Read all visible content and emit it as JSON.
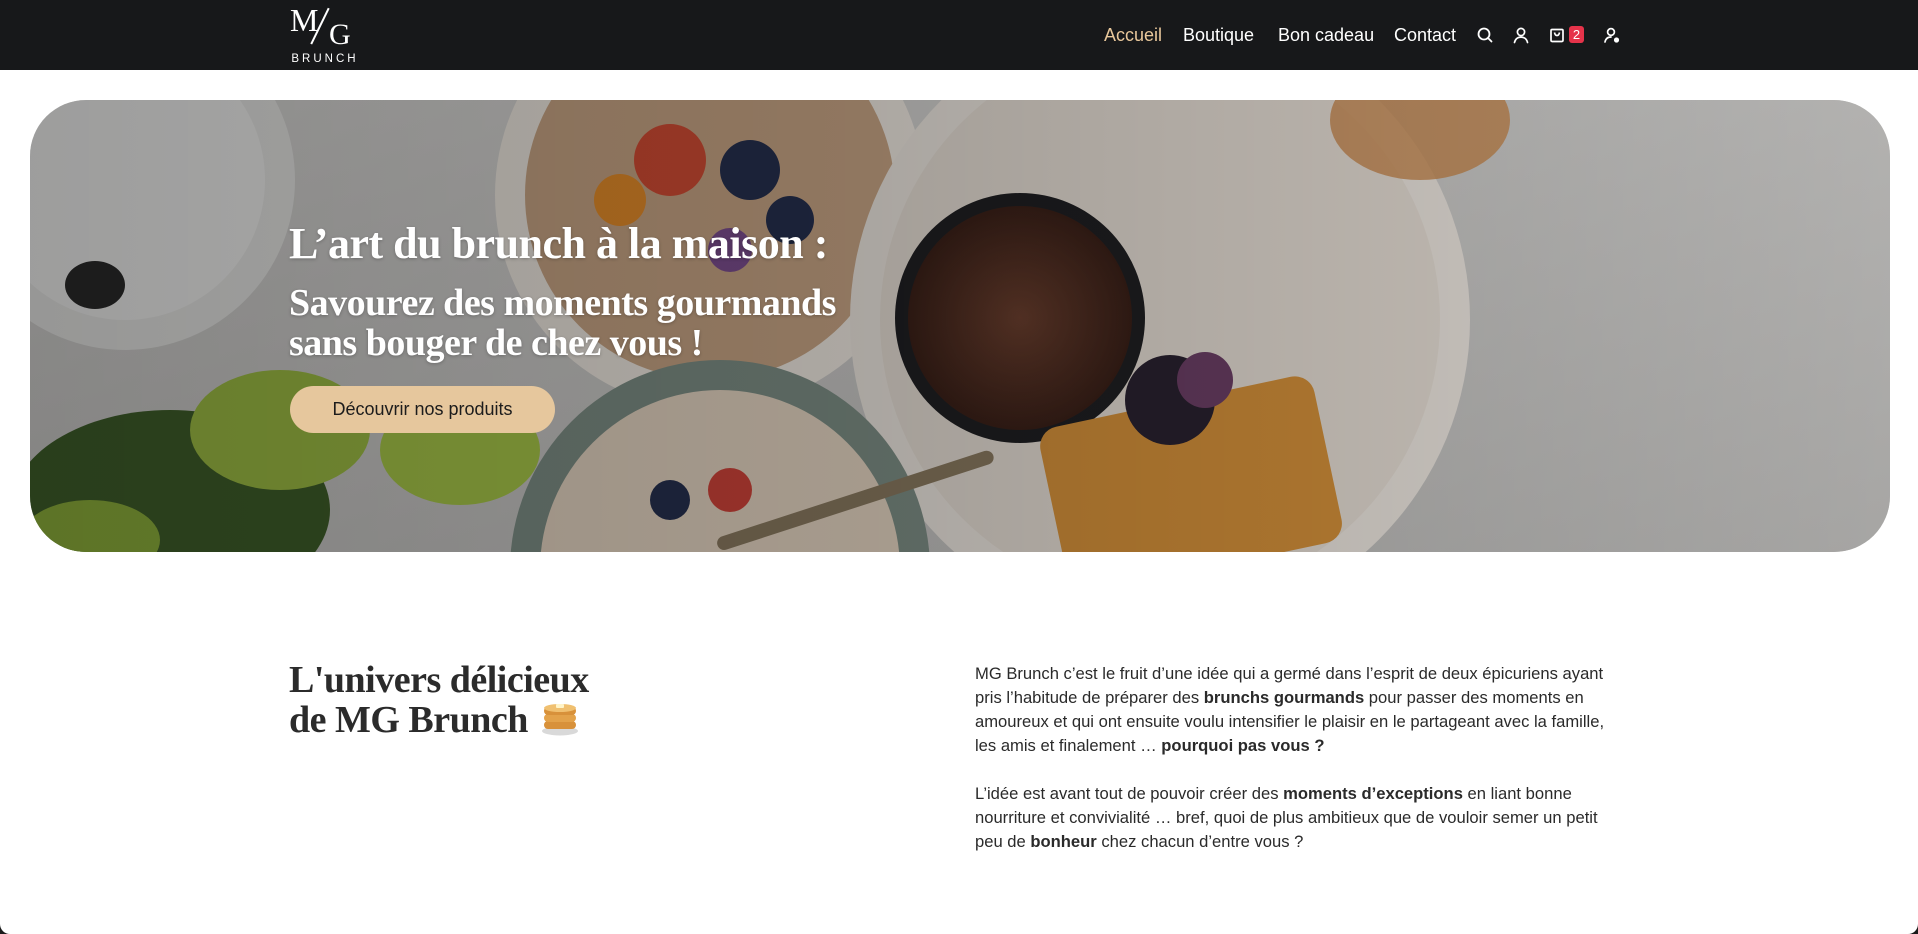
{
  "brand": {
    "logo_mark": "MG",
    "logo_text": "BRUNCH"
  },
  "nav": {
    "items": [
      {
        "label": "Accueil",
        "active": true
      },
      {
        "label": "Boutique",
        "active": false
      },
      {
        "label": "Bon cadeau",
        "active": false
      },
      {
        "label": "Contact",
        "active": false
      }
    ],
    "icons": [
      "search-icon",
      "account-icon",
      "cart-icon",
      "user-settings-icon"
    ],
    "cart_count": "2"
  },
  "hero": {
    "title": "L’art du brunch à la maison :",
    "subtitle_line1": "Savourez des moments gourmands",
    "subtitle_line2": "sans bouger de chez vous !",
    "cta_label": "Découvrir nos produits"
  },
  "about": {
    "title_line1": "L'univers délicieux",
    "title_line2": "de MG Brunch",
    "title_emoji": "pancakes-icon",
    "paragraph1": {
      "t1": "MG Brunch c’est le fruit d’une idée qui a germé dans l’esprit de deux épicuriens ayant pris l’habitude de préparer des ",
      "b1": "brunchs gourmands",
      "t2": " pour passer des moments en amoureux et qui ont ensuite voulu intensifier le plaisir en le partageant avec la famille, les amis et finalement … ",
      "b2": "pourquoi pas vous ?"
    },
    "paragraph2": {
      "t1": "L’idée est avant tout de pouvoir créer des ",
      "b1": "moments d’exceptions",
      "t2": " en liant bonne nourriture et convivialité … bref, quoi de plus ambitieux que de vouloir semer un petit peu de ",
      "b2": "bonheur",
      "t3": " chez chacun d’entre vous ?"
    }
  },
  "colors": {
    "header_bg": "#17181a",
    "accent": "#e6c79d",
    "active_nav": "#e8c79b",
    "badge": "#e6334a"
  }
}
